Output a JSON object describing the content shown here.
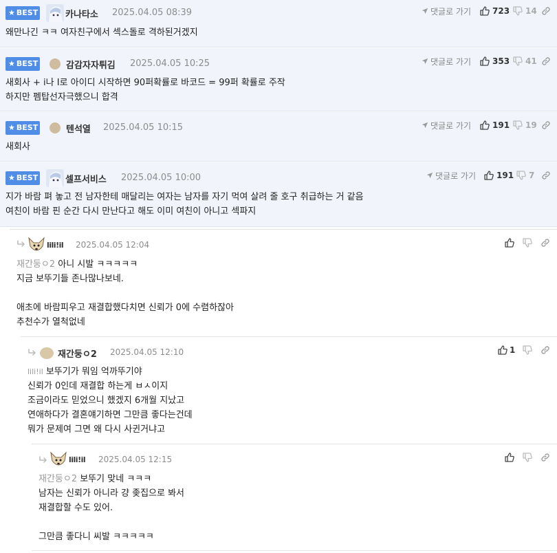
{
  "common": {
    "goto_label": "댓글로 가기",
    "best_label": "BEST"
  },
  "best_comments": [
    {
      "nick": "카나타소",
      "date": "2025.04.05 08:39",
      "up": "723",
      "down": "14",
      "content": "왜만나긴 ㅋㅋ 여자친구에서 섹스돌로 격하된거겠지"
    },
    {
      "nick": "감감자자튀김",
      "date": "2025.04.05 10:25",
      "up": "353",
      "down": "41",
      "content": "새회사 + i나 I로 아이디 시작하면 90퍼확률로 바코드 = 99퍼 확률로 주작\n하지만 펨탑선자극했으니 합격"
    },
    {
      "nick": "텐석열",
      "date": "2025.04.05 10:15",
      "up": "191",
      "down": "19",
      "content": "새회사"
    },
    {
      "nick": "셀프서비스",
      "date": "2025.04.05 10:00",
      "up": "191",
      "down": "7",
      "content": "지가 바람 펴 놓고 전 남자한테 매달리는 여자는 남자를 자기 먹여 살려 줄 호구 취급하는 거 같음\n여친이 바람 핀 순간 다시 만난다고 해도 이미 여친이 아니고 섹파지"
    }
  ],
  "replies": [
    {
      "nick": "lili!il",
      "date": "2025.04.05 12:04",
      "up": "",
      "mention": "재간둥ㅇ2",
      "first_line": " 아니 시발 ㅋㅋㅋㅋㅋ",
      "body": "지금 보뚜기들 존나많나보네.\n\n애초에 바람피우고 재결합했다치면 신뢰가 0에 수렴하잖아\n추천수가 열척없네"
    },
    {
      "nick": "재간둥ㅇ2",
      "date": "2025.04.05 12:10",
      "up": "1",
      "mention": "lili!il",
      "first_line": " 보뚜기가 뭐임 억까뚜기야",
      "body": "신뢰가 0인데 재결합 하는게 ㅂㅅ이지\n조금이라도 믿었으니 했겠지 6개월 지났고\n연애하다가 결혼얘기하면 그만큼 좋다는건데\n뭐가 문제여 그면 왜 다시 사귄거냐고"
    },
    {
      "nick": "lili!il",
      "date": "2025.04.05 12:15",
      "up": "",
      "mention": "재간둥ㅇ2",
      "first_line": " 보뚜기 맞네 ㅋㅋㅋ",
      "body": "남자는 신뢰가 아니라 걍 좆집으로 봐서\n재결합할 수도 있어.\n\n그만큼 좋다니 씨발 ㅋㅋㅋㅋㅋ"
    }
  ],
  "colors": {
    "best_bg": "#f1f4fa",
    "badge": "#4f8de6",
    "mention": "#9a9a9a"
  }
}
